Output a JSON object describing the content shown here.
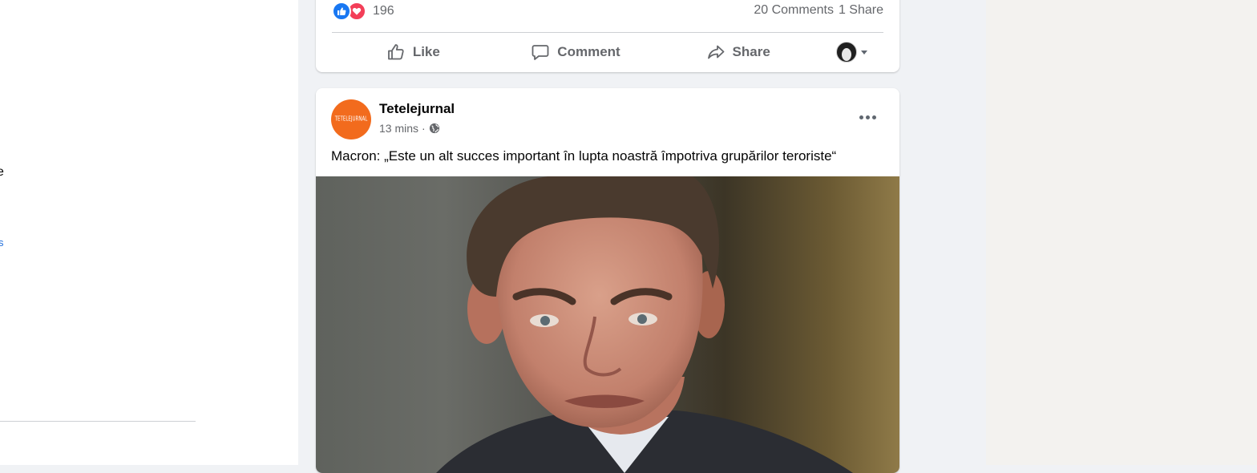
{
  "left_fragments": {
    "e": "e",
    "s": "s"
  },
  "prev_post": {
    "reaction_count": "196",
    "comments": "20 Comments",
    "shares": "1 Share",
    "actions": {
      "like": "Like",
      "comment": "Comment",
      "share": "Share"
    }
  },
  "post": {
    "page_name": "Tetelejurnal",
    "page_logo_text": "TETELEJURNAL",
    "time": "13 mins",
    "separator": "·",
    "text": "Macron: „Este un alt succes important în lupta noastră împotriva grupărilor teroriste“"
  },
  "colors": {
    "like_blue": "#1877f2",
    "love_red": "#f33e58",
    "brand_orange": "#f26b1d",
    "link_blue": "#216fdb"
  },
  "icons": [
    "like-reaction-icon",
    "love-reaction-icon",
    "thumbs-up-icon",
    "comment-icon",
    "share-icon",
    "globe-icon",
    "more-icon",
    "caret-down-icon"
  ]
}
